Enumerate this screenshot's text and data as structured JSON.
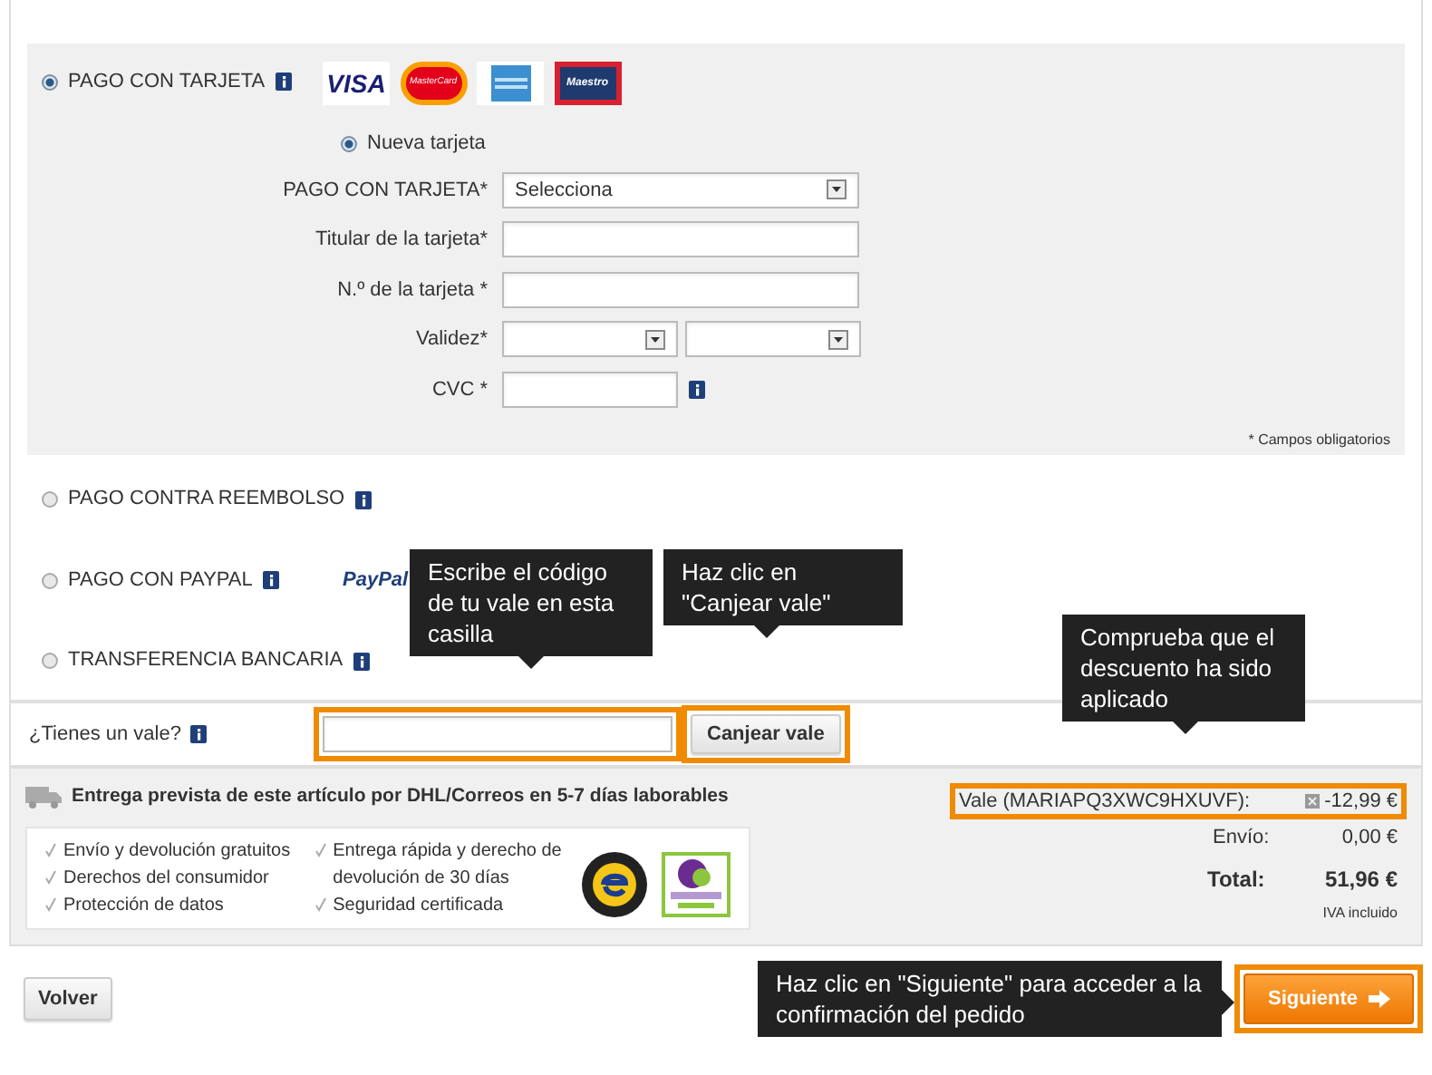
{
  "payment_methods": [
    {
      "label": "PAGO CON TARJETA",
      "selected": true,
      "kind": "card"
    },
    {
      "label": "PAGO CONTRA REEMBOLSO",
      "selected": false,
      "kind": "plain"
    },
    {
      "label": "PAGO CON PAYPAL",
      "selected": false,
      "kind": "paypal",
      "logo": "PayPal"
    },
    {
      "label": "TRANSFERENCIA BANCARIA",
      "selected": false,
      "kind": "plain"
    }
  ],
  "card_logos": [
    {
      "kind": "visa",
      "text": "VISA"
    },
    {
      "kind": "mastercard",
      "text": "MasterCard"
    },
    {
      "kind": "amex"
    },
    {
      "kind": "maestro",
      "text": "Maestro"
    }
  ],
  "card_option": {
    "label": "Nueva tarjeta",
    "selected": true
  },
  "card_form": {
    "fields": [
      {
        "label": "PAGO CON TARJETA*",
        "kind": "select",
        "value": "Selecciona"
      },
      {
        "label": "Titular de la tarjeta*",
        "kind": "text"
      },
      {
        "label": "N.º de la tarjeta *",
        "kind": "text"
      },
      {
        "label": "Validez*",
        "kind": "select_pair"
      },
      {
        "label": "CVC *",
        "kind": "cvc"
      }
    ],
    "note": "* Campos obligatorios"
  },
  "voucher": {
    "label": "¿Tienes un vale?",
    "button": "Canjear vale",
    "highlighted": true
  },
  "delivery": "Entrega prevista de este artículo por DHL/Correos en 5-7 días laborables",
  "guarantees": [
    [
      "Envío y devolución gratuitos",
      "Derechos del consumidor",
      "Protección de datos"
    ],
    [
      "Entrega rápida y derecho de devolución de 30 días",
      "Seguridad certificada"
    ]
  ],
  "totals": [
    {
      "kind": "voucher",
      "label": "Vale (MARIAPQ3XWC9HXUVF):",
      "value": "-12,99 €",
      "highlighted": true
    },
    {
      "kind": "shipping",
      "label": "Envío:",
      "value": "0,00 €",
      "highlighted": false
    },
    {
      "kind": "total",
      "label": "Total:",
      "value": "51,96 €",
      "highlighted": false
    }
  ],
  "vat_note": "IVA incluido",
  "buttons": {
    "back": "Volver",
    "next": "Siguiente",
    "next_highlighted": true
  },
  "callouts": [
    {
      "text": "Escribe el código de tu vale en esta casilla",
      "kind": "down"
    },
    {
      "text": "Haz clic en \"Canjear vale\"",
      "kind": "down"
    },
    {
      "text": "Comprueba que el descuento ha sido aplicado",
      "kind": "down"
    },
    {
      "text": "Haz clic en \"Siguiente\" para acceder a la confirmación del pedido",
      "kind": "right"
    }
  ]
}
